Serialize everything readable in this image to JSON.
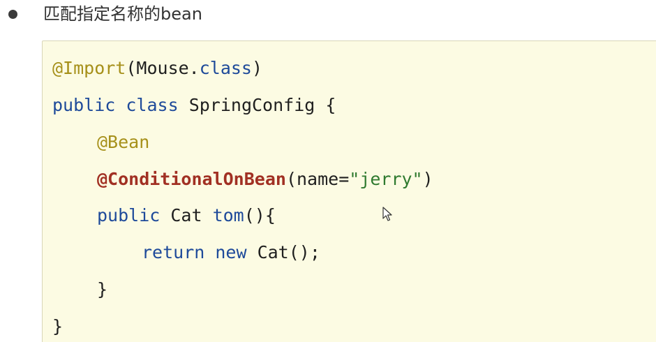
{
  "heading": {
    "text": "匹配指定名称的bean"
  },
  "code": {
    "line1": {
      "annotation": "@Import",
      "open": "(Mouse.",
      "keyword": "class",
      "close": ")"
    },
    "line2": {
      "kw1": "public",
      "kw2": "class",
      "rest": " SpringConfig {"
    },
    "line3": {
      "annotation": "@Bean"
    },
    "line4": {
      "annotation": "@ConditionalOnBean",
      "open": "(name=",
      "string": "\"jerry\"",
      "close": ")"
    },
    "line5": {
      "kw1": "public",
      "type": " Cat ",
      "method": "tom",
      "rest": "(){"
    },
    "line6": {
      "kw1": "return",
      "kw2": "new",
      "rest": " Cat();"
    },
    "line7": {
      "text": "}"
    },
    "line8": {
      "text": "}"
    }
  },
  "colors": {
    "background": "#fcfbe3",
    "annotation": "#a6901a",
    "annotation_strong": "#a13023",
    "keyword": "#1e4a9a",
    "string": "#2f7a2f"
  },
  "icons": {
    "cursor": "mouse-pointer-icon",
    "bullet": "bullet-dot-icon"
  }
}
